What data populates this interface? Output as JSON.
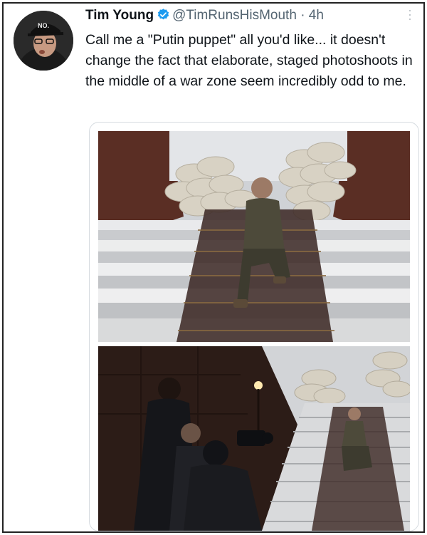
{
  "tweet": {
    "author_name": "Tim Young",
    "handle": "@TimRunsHisMouth",
    "separator": "·",
    "time": "4h",
    "text": "Call me a \"Putin puppet\" all you'd like... it doesn't change the fact that elaborate, staged photoshoots in the middle of a war zone seem incredibly odd to me.",
    "avatar_cap_text": "NO."
  },
  "icons": {
    "verified": "verified-badge-icon",
    "more": "more-options-icon"
  },
  "colors": {
    "verified_blue": "#1d9bf0",
    "text": "#0f1419",
    "secondary": "#536471"
  }
}
